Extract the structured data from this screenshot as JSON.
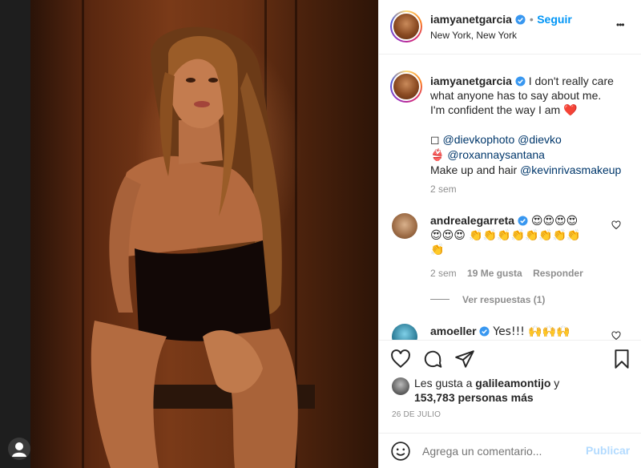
{
  "post": {
    "username": "iamyanetgarcia",
    "follow_label": "Seguir",
    "separator": "•",
    "location": "New York, New York",
    "more_label": "•••"
  },
  "caption": {
    "username": "iamyanetgarcia",
    "line1": "I don't really care",
    "line2": "what anyone has to say about me.",
    "line3": "I'm confident the way I am",
    "line3_emoji": "❤️",
    "credit1_icon": "◻",
    "credit1_a": "@dievkophoto",
    "credit1_b": "@dievko",
    "credit2_icon": "👙",
    "credit2_a": "@roxannaysantana",
    "credit3_prefix": "Make up and hair",
    "credit3_a": "@kevinrivasmakeup",
    "time": "2 sem"
  },
  "comments": [
    {
      "username": "andrealegarreta",
      "text_line1": "😍😍😍😍",
      "text_line2": "😍😍😍 👏👏👏👏👏👏👏👏",
      "text_line3": "👏",
      "time": "2 sem",
      "likes": "19 Me gusta",
      "reply": "Responder",
      "view_replies": "Ver respuestas (1)"
    },
    {
      "username": "amoeller",
      "text": "Yes!!! 🙌🙌🙌"
    }
  ],
  "likes": {
    "prefix": "Les gusta a",
    "user": "galileamontijo",
    "conj": "y",
    "count": "153,783 personas más"
  },
  "date": "26 DE JULIO",
  "composer": {
    "placeholder": "Agrega un comentario...",
    "post_label": "Publicar"
  },
  "colors": {
    "link_blue": "#0095f6",
    "mention": "#00376b",
    "verified": "#3897f0",
    "heart_red": "#ed4956"
  }
}
